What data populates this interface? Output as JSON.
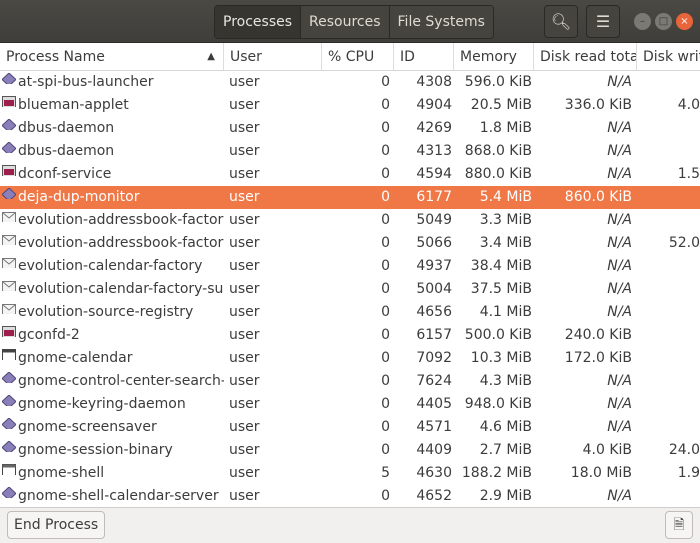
{
  "tabs": [
    "Processes",
    "Resources",
    "File Systems"
  ],
  "columns": [
    "Process Name",
    "User",
    "% CPU",
    "ID",
    "Memory",
    "Disk read tota",
    "Disk writ"
  ],
  "rows": [
    [
      "at-spi-bus-launcher",
      "user",
      "0",
      "4308",
      "596.0 KiB",
      "N/A",
      "",
      "diamond"
    ],
    [
      "blueman-applet",
      "user",
      "0",
      "4904",
      "20.5 MiB",
      "336.0 KiB",
      "4.0",
      "app"
    ],
    [
      "dbus-daemon",
      "user",
      "0",
      "4269",
      "1.8 MiB",
      "N/A",
      "",
      "diamond"
    ],
    [
      "dbus-daemon",
      "user",
      "0",
      "4313",
      "868.0 KiB",
      "N/A",
      "",
      "diamond"
    ],
    [
      "dconf-service",
      "user",
      "0",
      "4594",
      "880.0 KiB",
      "N/A",
      "1.5",
      "app"
    ],
    [
      "deja-dup-monitor",
      "user",
      "0",
      "6177",
      "5.4 MiB",
      "860.0 KiB",
      "",
      "diamond"
    ],
    [
      "evolution-addressbook-factory",
      "user",
      "0",
      "5049",
      "3.3 MiB",
      "N/A",
      "",
      "mail"
    ],
    [
      "evolution-addressbook-factory",
      "user",
      "0",
      "5066",
      "3.4 MiB",
      "N/A",
      "52.0",
      "mail"
    ],
    [
      "evolution-calendar-factory",
      "user",
      "0",
      "4937",
      "38.4 MiB",
      "N/A",
      "",
      "mail"
    ],
    [
      "evolution-calendar-factory-sub",
      "user",
      "0",
      "5004",
      "37.5 MiB",
      "N/A",
      "",
      "mail"
    ],
    [
      "evolution-source-registry",
      "user",
      "0",
      "4656",
      "4.1 MiB",
      "N/A",
      "",
      "mail"
    ],
    [
      "gconfd-2",
      "user",
      "0",
      "6157",
      "500.0 KiB",
      "240.0 KiB",
      "",
      "app"
    ],
    [
      "gnome-calendar",
      "user",
      "0",
      "7092",
      "10.3 MiB",
      "172.0 KiB",
      "",
      "cal"
    ],
    [
      "gnome-control-center-search-p",
      "user",
      "0",
      "7624",
      "4.3 MiB",
      "N/A",
      "",
      "diamond"
    ],
    [
      "gnome-keyring-daemon",
      "user",
      "0",
      "4405",
      "948.0 KiB",
      "N/A",
      "",
      "diamond"
    ],
    [
      "gnome-screensaver",
      "user",
      "0",
      "4571",
      "4.6 MiB",
      "N/A",
      "",
      "diamond"
    ],
    [
      "gnome-session-binary",
      "user",
      "0",
      "4409",
      "2.7 MiB",
      "4.0 KiB",
      "24.0",
      "diamond"
    ],
    [
      "gnome-shell",
      "user",
      "5",
      "4630",
      "188.2 MiB",
      "18.0 MiB",
      "1.9",
      "window"
    ],
    [
      "gnome-shell-calendar-server",
      "user",
      "0",
      "4652",
      "2.9 MiB",
      "N/A",
      "",
      "diamond"
    ]
  ],
  "selected_index": 5,
  "footer": {
    "end_process": "End Process"
  },
  "colors": {
    "selection": "#f07746",
    "header": "#45443f"
  }
}
